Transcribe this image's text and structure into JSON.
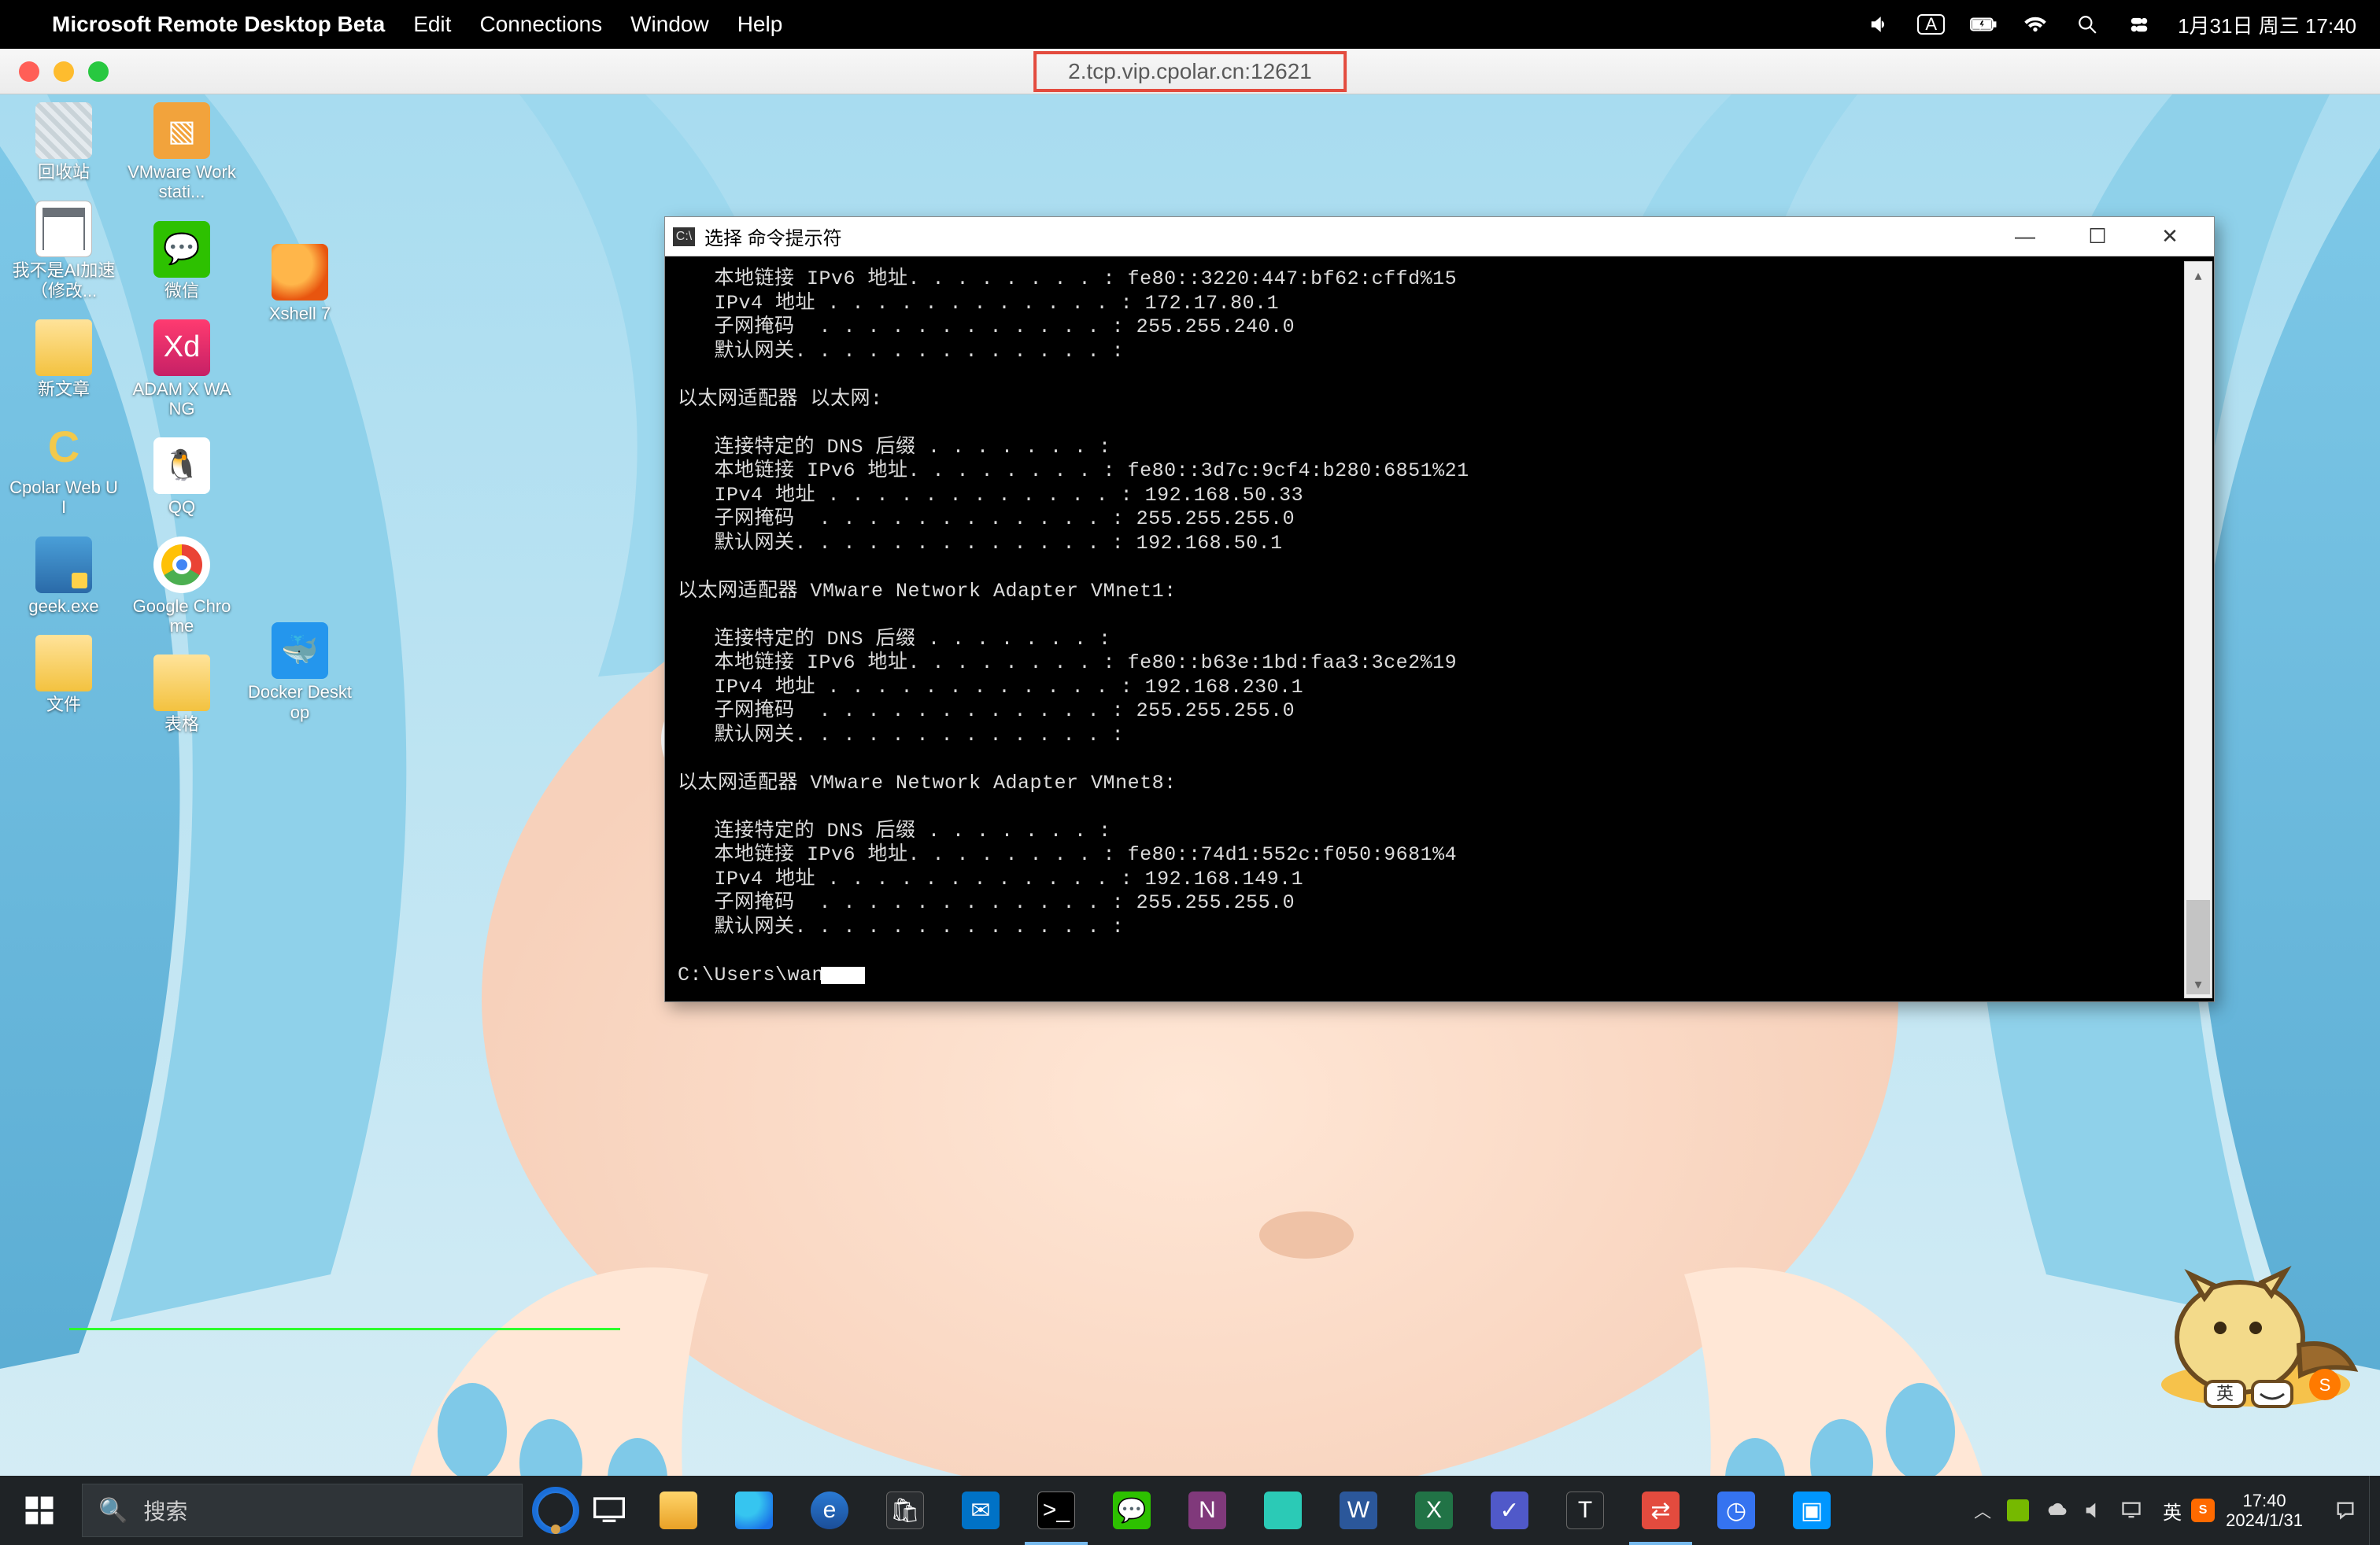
{
  "mac": {
    "app_name": "Microsoft Remote Desktop Beta",
    "menu": {
      "edit": "Edit",
      "connections": "Connections",
      "window": "Window",
      "help": "Help"
    },
    "status": {
      "input_mode": "A",
      "date_time": "1月31日 周三  17:40"
    },
    "title_center": "2.tcp.vip.cpolar.cn:12621"
  },
  "desktop_icons": {
    "col1": [
      {
        "id": "recycle-bin",
        "label": "回收站"
      },
      {
        "id": "ai-txt",
        "label": "我不是AI加速（修改..."
      },
      {
        "id": "new-folder",
        "label": "新文章"
      },
      {
        "id": "cpolar",
        "label": "Cpolar Web UI"
      },
      {
        "id": "geek",
        "label": "geek.exe"
      },
      {
        "id": "files",
        "label": "文件"
      }
    ],
    "col2": [
      {
        "id": "vmware",
        "label": "VMware Workstati..."
      },
      {
        "id": "wechat",
        "label": "微信"
      },
      {
        "id": "adamx",
        "label": "ADAM X WANG"
      },
      {
        "id": "qq",
        "label": "QQ"
      },
      {
        "id": "chrome",
        "label": "Google Chrome"
      },
      {
        "id": "tables",
        "label": "表格"
      }
    ],
    "col3": [
      {
        "id": "xshell",
        "label": "Xshell 7"
      },
      {
        "id": "docker",
        "label": "Docker Desktop"
      }
    ]
  },
  "cmd": {
    "title": "选择 命令提示符",
    "body": "   本地链接 IPv6 地址. . . . . . . . : fe80::3220:447:bf62:cffd%15\n   IPv4 地址 . . . . . . . . . . . . : 172.17.80.1\n   子网掩码  . . . . . . . . . . . . : 255.255.240.0\n   默认网关. . . . . . . . . . . . . :\n\n以太网适配器 以太网:\n\n   连接特定的 DNS 后缀 . . . . . . . :\n   本地链接 IPv6 地址. . . . . . . . : fe80::3d7c:9cf4:b280:6851%21\n   IPv4 地址 . . . . . . . . . . . . : 192.168.50.33\n   子网掩码  . . . . . . . . . . . . : 255.255.255.0\n   默认网关. . . . . . . . . . . . . : 192.168.50.1\n\n以太网适配器 VMware Network Adapter VMnet1:\n\n   连接特定的 DNS 后缀 . . . . . . . :\n   本地链接 IPv6 地址. . . . . . . . : fe80::b63e:1bd:faa3:3ce2%19\n   IPv4 地址 . . . . . . . . . . . . : 192.168.230.1\n   子网掩码  . . . . . . . . . . . . : 255.255.255.0\n   默认网关. . . . . . . . . . . . . :\n\n以太网适配器 VMware Network Adapter VMnet8:\n\n   连接特定的 DNS 后缀 . . . . . . . :\n   本地链接 IPv6 地址. . . . . . . . : fe80::74d1:552c:f050:9681%4\n   IPv4 地址 . . . . . . . . . . . . : 192.168.149.1\n   子网掩码  . . . . . . . . . . . . : 255.255.255.0\n   默认网关. . . . . . . . . . . . . :\n\nC:\\Users\\wang>"
  },
  "taskbar": {
    "search_placeholder": "搜索",
    "lang": "英",
    "clock_time": "17:40",
    "clock_date": "2024/1/31",
    "sogou_ime": "英"
  }
}
